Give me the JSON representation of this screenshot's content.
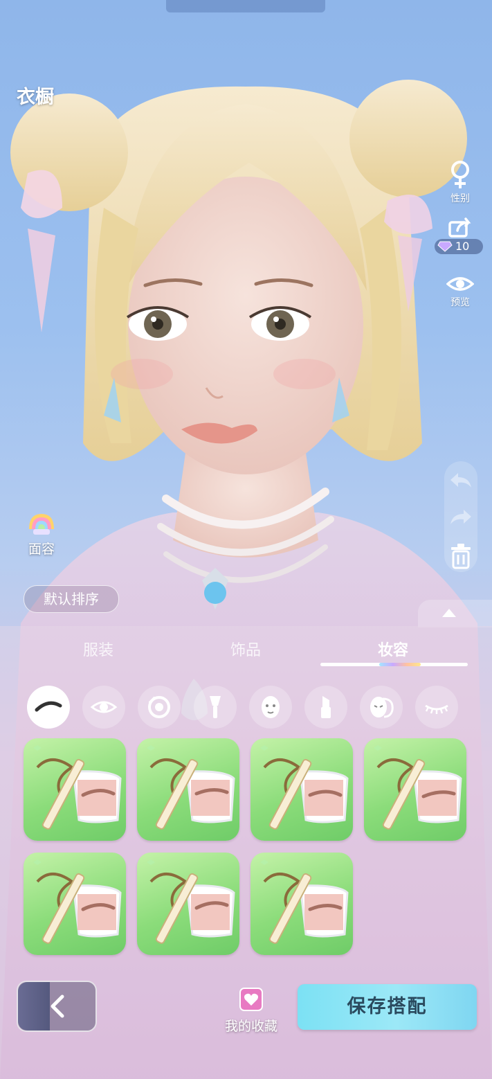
{
  "header": {
    "title": "衣橱"
  },
  "side_buttons": {
    "gender_label": "性别",
    "share_reward_count": "10",
    "preview_label": "预览"
  },
  "face_mode_label": "面容",
  "sort_label": "默认排序",
  "tabs": [
    {
      "label": "服装",
      "active": false
    },
    {
      "label": "饰品",
      "active": false
    },
    {
      "label": "妆容",
      "active": true
    }
  ],
  "makeup_categories": [
    {
      "icon": "eyebrow-icon",
      "active": true
    },
    {
      "icon": "eye-icon",
      "active": false
    },
    {
      "icon": "iris-icon",
      "active": false
    },
    {
      "icon": "brush-icon",
      "active": false
    },
    {
      "icon": "face-paint-icon",
      "active": false
    },
    {
      "icon": "lipstick-icon",
      "active": false
    },
    {
      "icon": "mask-icon",
      "active": false
    },
    {
      "icon": "eyelash-icon",
      "active": false
    }
  ],
  "items": [
    {
      "icon": "eyebrow-pencil-item"
    },
    {
      "icon": "eyebrow-pencil-item"
    },
    {
      "icon": "eyebrow-pencil-item"
    },
    {
      "icon": "eyebrow-pencil-item"
    },
    {
      "icon": "eyebrow-pencil-item"
    },
    {
      "icon": "eyebrow-pencil-item"
    },
    {
      "icon": "eyebrow-pencil-item"
    }
  ],
  "footer": {
    "favorites_label": "我的收藏",
    "save_label": "保存搭配"
  },
  "colors": {
    "sky": "#9cc0ef",
    "card_green": "#8bdc7a",
    "save_button": "#9ce8f7",
    "hair": "#f2e1b2"
  }
}
